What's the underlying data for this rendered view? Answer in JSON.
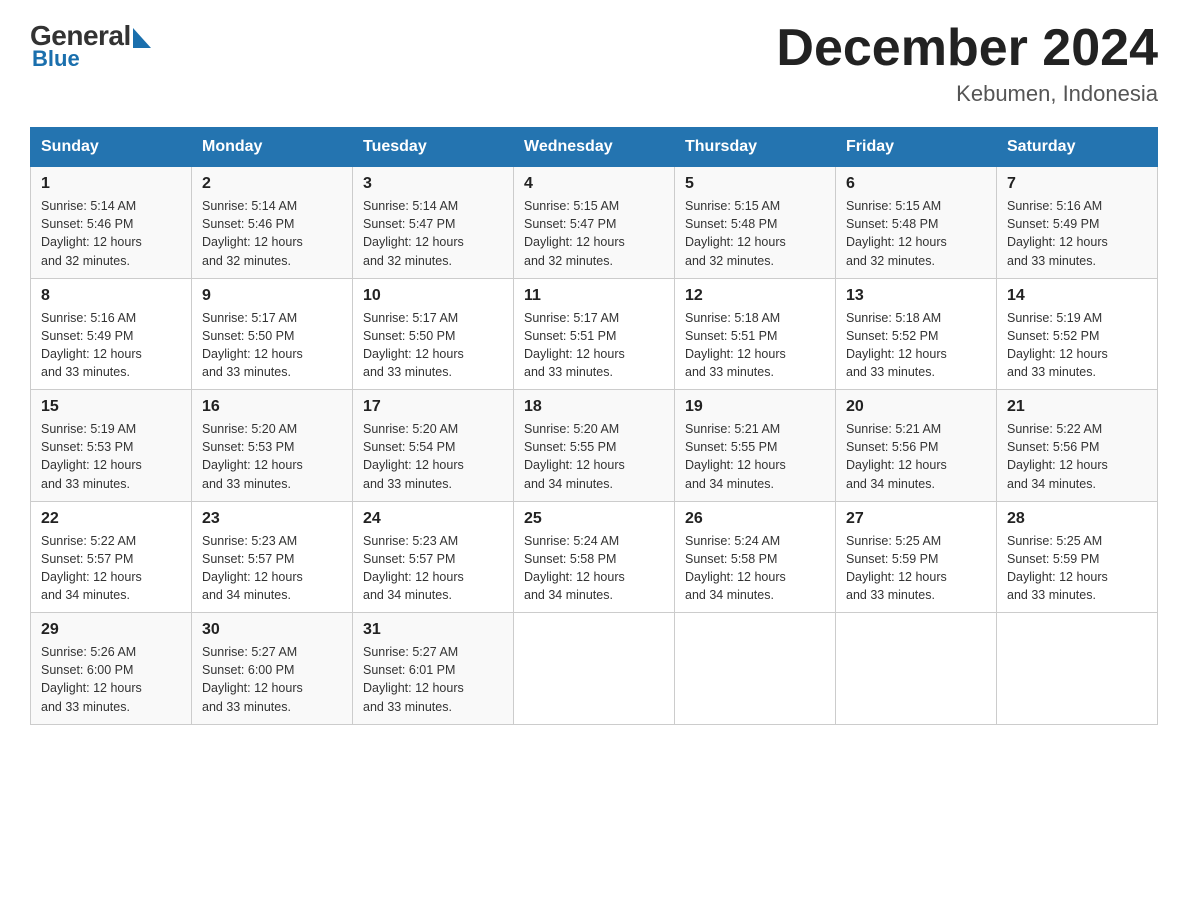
{
  "logo": {
    "general": "General",
    "blue": "Blue"
  },
  "title": {
    "month_year": "December 2024",
    "location": "Kebumen, Indonesia"
  },
  "days_of_week": [
    "Sunday",
    "Monday",
    "Tuesday",
    "Wednesday",
    "Thursday",
    "Friday",
    "Saturday"
  ],
  "weeks": [
    [
      {
        "day": "1",
        "sunrise": "5:14 AM",
        "sunset": "5:46 PM",
        "daylight": "12 hours and 32 minutes."
      },
      {
        "day": "2",
        "sunrise": "5:14 AM",
        "sunset": "5:46 PM",
        "daylight": "12 hours and 32 minutes."
      },
      {
        "day": "3",
        "sunrise": "5:14 AM",
        "sunset": "5:47 PM",
        "daylight": "12 hours and 32 minutes."
      },
      {
        "day": "4",
        "sunrise": "5:15 AM",
        "sunset": "5:47 PM",
        "daylight": "12 hours and 32 minutes."
      },
      {
        "day": "5",
        "sunrise": "5:15 AM",
        "sunset": "5:48 PM",
        "daylight": "12 hours and 32 minutes."
      },
      {
        "day": "6",
        "sunrise": "5:15 AM",
        "sunset": "5:48 PM",
        "daylight": "12 hours and 32 minutes."
      },
      {
        "day": "7",
        "sunrise": "5:16 AM",
        "sunset": "5:49 PM",
        "daylight": "12 hours and 33 minutes."
      }
    ],
    [
      {
        "day": "8",
        "sunrise": "5:16 AM",
        "sunset": "5:49 PM",
        "daylight": "12 hours and 33 minutes."
      },
      {
        "day": "9",
        "sunrise": "5:17 AM",
        "sunset": "5:50 PM",
        "daylight": "12 hours and 33 minutes."
      },
      {
        "day": "10",
        "sunrise": "5:17 AM",
        "sunset": "5:50 PM",
        "daylight": "12 hours and 33 minutes."
      },
      {
        "day": "11",
        "sunrise": "5:17 AM",
        "sunset": "5:51 PM",
        "daylight": "12 hours and 33 minutes."
      },
      {
        "day": "12",
        "sunrise": "5:18 AM",
        "sunset": "5:51 PM",
        "daylight": "12 hours and 33 minutes."
      },
      {
        "day": "13",
        "sunrise": "5:18 AM",
        "sunset": "5:52 PM",
        "daylight": "12 hours and 33 minutes."
      },
      {
        "day": "14",
        "sunrise": "5:19 AM",
        "sunset": "5:52 PM",
        "daylight": "12 hours and 33 minutes."
      }
    ],
    [
      {
        "day": "15",
        "sunrise": "5:19 AM",
        "sunset": "5:53 PM",
        "daylight": "12 hours and 33 minutes."
      },
      {
        "day": "16",
        "sunrise": "5:20 AM",
        "sunset": "5:53 PM",
        "daylight": "12 hours and 33 minutes."
      },
      {
        "day": "17",
        "sunrise": "5:20 AM",
        "sunset": "5:54 PM",
        "daylight": "12 hours and 33 minutes."
      },
      {
        "day": "18",
        "sunrise": "5:20 AM",
        "sunset": "5:55 PM",
        "daylight": "12 hours and 34 minutes."
      },
      {
        "day": "19",
        "sunrise": "5:21 AM",
        "sunset": "5:55 PM",
        "daylight": "12 hours and 34 minutes."
      },
      {
        "day": "20",
        "sunrise": "5:21 AM",
        "sunset": "5:56 PM",
        "daylight": "12 hours and 34 minutes."
      },
      {
        "day": "21",
        "sunrise": "5:22 AM",
        "sunset": "5:56 PM",
        "daylight": "12 hours and 34 minutes."
      }
    ],
    [
      {
        "day": "22",
        "sunrise": "5:22 AM",
        "sunset": "5:57 PM",
        "daylight": "12 hours and 34 minutes."
      },
      {
        "day": "23",
        "sunrise": "5:23 AM",
        "sunset": "5:57 PM",
        "daylight": "12 hours and 34 minutes."
      },
      {
        "day": "24",
        "sunrise": "5:23 AM",
        "sunset": "5:57 PM",
        "daylight": "12 hours and 34 minutes."
      },
      {
        "day": "25",
        "sunrise": "5:24 AM",
        "sunset": "5:58 PM",
        "daylight": "12 hours and 34 minutes."
      },
      {
        "day": "26",
        "sunrise": "5:24 AM",
        "sunset": "5:58 PM",
        "daylight": "12 hours and 34 minutes."
      },
      {
        "day": "27",
        "sunrise": "5:25 AM",
        "sunset": "5:59 PM",
        "daylight": "12 hours and 33 minutes."
      },
      {
        "day": "28",
        "sunrise": "5:25 AM",
        "sunset": "5:59 PM",
        "daylight": "12 hours and 33 minutes."
      }
    ],
    [
      {
        "day": "29",
        "sunrise": "5:26 AM",
        "sunset": "6:00 PM",
        "daylight": "12 hours and 33 minutes."
      },
      {
        "day": "30",
        "sunrise": "5:27 AM",
        "sunset": "6:00 PM",
        "daylight": "12 hours and 33 minutes."
      },
      {
        "day": "31",
        "sunrise": "5:27 AM",
        "sunset": "6:01 PM",
        "daylight": "12 hours and 33 minutes."
      },
      null,
      null,
      null,
      null
    ]
  ],
  "labels": {
    "sunrise": "Sunrise:",
    "sunset": "Sunset:",
    "daylight": "Daylight:"
  }
}
